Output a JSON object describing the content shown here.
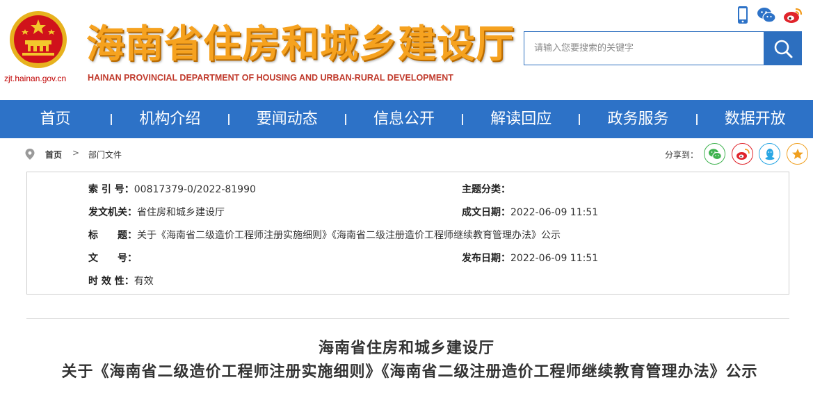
{
  "header": {
    "domain": "zjt.hainan.gov.cn",
    "title": "海南省住房和城乡建设厅",
    "subtitle": "HAINAN PROVINCIAL DEPARTMENT OF HOUSING AND URBAN-RURAL DEVELOPMENT",
    "icons": [
      "mobile-icon",
      "wechat-icon",
      "weibo-icon"
    ]
  },
  "search": {
    "placeholder": "请输入您要搜索的关键字"
  },
  "nav": {
    "items": [
      "首页",
      "机构介绍",
      "要闻动态",
      "信息公开",
      "解读回应",
      "政务服务",
      "数据开放"
    ]
  },
  "breadcrumb": {
    "home": "首页",
    "separator": ">",
    "current": "部门文件",
    "share_label": "分享到："
  },
  "meta": {
    "index_label": "索 引 号：",
    "index_value": "00817379-0/2022-81990",
    "topic_label": "主题分类：",
    "topic_value": "",
    "issuer_label": "发文机关：",
    "issuer_value": "省住房和城乡建设厅",
    "created_label": "成文日期：",
    "created_value": "2022-06-09 11:51",
    "title_label": "标　　题：",
    "title_value": "关于《海南省二级造价工程师注册实施细则》《海南省二级注册造价工程师继续教育管理办法》公示",
    "docno_label": "文　　号：",
    "docno_value": "",
    "published_label": "发布日期：",
    "published_value": "2022-06-09 11:51",
    "validity_label": "时 效 性：",
    "validity_value": "有效"
  },
  "article": {
    "org": "海南省住房和城乡建设厅",
    "title": "关于《海南省二级造价工程师注册实施细则》《海南省二级注册造价工程师继续教育管理办法》公示"
  },
  "colors": {
    "primary": "#2d72c7",
    "title_gold": "#f6a21f",
    "emblem_red": "#d0121b"
  }
}
